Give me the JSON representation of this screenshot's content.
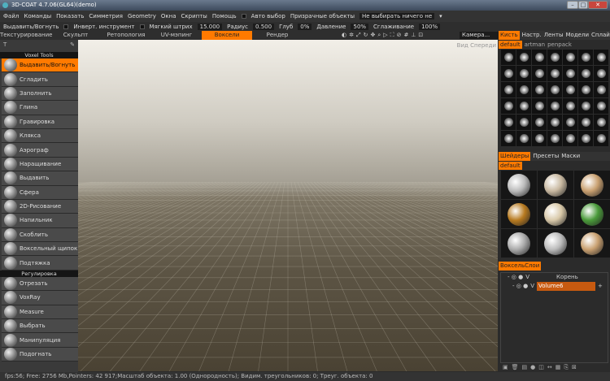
{
  "title": "3D-COAT 4.7.06(GL64)(demo)",
  "menu": [
    "Файл",
    "Команды",
    "Показать",
    "Симметрия",
    "Geometry",
    "Окна",
    "Скрипты",
    "Помощь"
  ],
  "menu_extra": {
    "auto": "Авто выбор",
    "ghost": "Призрачные объекты",
    "ghost_value": "Не выбирать ничего не"
  },
  "options": {
    "tool": "Выдавить/Вогнуть",
    "invert": "Инверт. инструмент",
    "soft": "Мягкий штрих",
    "soft_val": "15.000",
    "radius": "Радиус",
    "radius_val": "0.500",
    "depth": "Глуб",
    "depth_val": "0%",
    "pressure": "Давление",
    "pressure_val": "50%",
    "smooth": "Сглаживание",
    "smooth_val": "100%"
  },
  "tabs": [
    {
      "label": "Текстурирование",
      "active": false
    },
    {
      "label": "Скульпт",
      "active": false
    },
    {
      "label": "Ретопология",
      "active": false
    },
    {
      "label": "UV-мэпинг",
      "active": false
    },
    {
      "label": "Воксели",
      "active": true
    },
    {
      "label": "Рендер",
      "active": false
    }
  ],
  "camera": "Камера...",
  "view_label": "Вид Спереди",
  "left_panel": {
    "header": "Voxel Tools",
    "items": [
      "Выдавить/Вогнуть",
      "Сгладить",
      "Заполнить",
      "Глина",
      "Гравировка",
      "Клякса",
      "Аэрограф",
      "Наращивание",
      "Выдавить",
      "Сфера",
      "2D-Рисование",
      "Напильник",
      "Скоблить",
      "Воксельный щипок",
      "Подтяжка"
    ],
    "header2": "Регулировка",
    "items2": [
      "Отрезать",
      "VoxRay",
      "Measure",
      "Выбрать",
      "Манипуляция",
      "Подогнать"
    ],
    "active": "Выдавить/Вогнуть"
  },
  "right_panel": {
    "tabs": [
      "Кисть",
      "Настр.",
      "Ленты",
      "Модели",
      "Сплайн"
    ],
    "brush_sets": [
      "default",
      "artman",
      "penpack"
    ],
    "shader_tabs": [
      "Шейдеры",
      "Пресеты",
      "Маски"
    ],
    "shader_set": "default",
    "layers_tab": "ВоксельСлои",
    "layers": [
      {
        "name": "Корень",
        "v": "V"
      },
      {
        "name": "Volume6",
        "v": "V"
      }
    ]
  },
  "status": "fps:56;    Free: 2756 Mb,Pointers: 42 917;Масштаб объекта: 1.00 (Однородность); Видим. треугольников: 0; Треуг. объекта: 0",
  "colors": {
    "accent": "#ff7a00"
  }
}
